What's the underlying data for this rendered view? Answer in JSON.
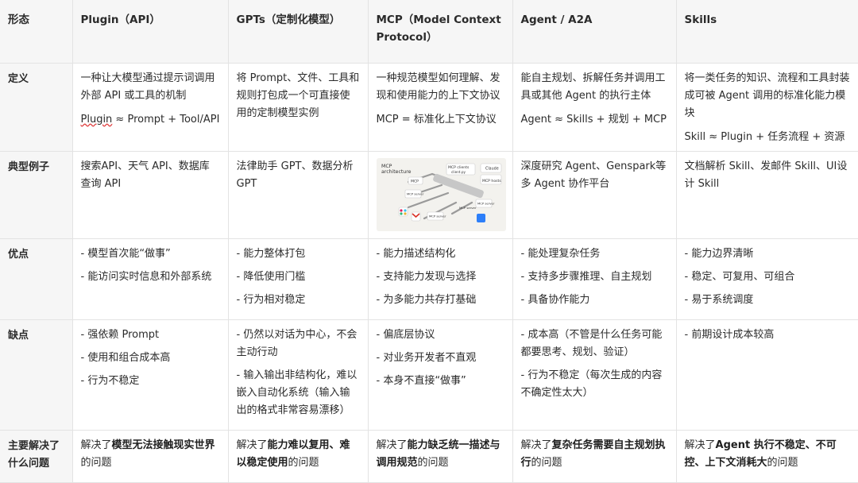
{
  "header": {
    "row_label": "形态",
    "cols": [
      "Plugin（API）",
      "GPTs（定制化模型）",
      "MCP（Model Context Protocol）",
      "Agent / A2A",
      "Skills"
    ]
  },
  "rows": {
    "definition": {
      "label": "定义",
      "plugin": [
        "一种让大模型通过提示词调用外部 API 或工具的机制"
      ],
      "plugin_formula_word": "Plugin",
      "plugin_formula_rest": " ≈ Prompt + Tool/API",
      "gpts": [
        "将 Prompt、文件、工具和规则打包成一个可直接使用的定制模型实例"
      ],
      "mcp": [
        "一种规范模型如何理解、发现和使用能力的上下文协议",
        "MCP = 标准化上下文协议"
      ],
      "agent": [
        "能自主规划、拆解任务并调用工具或其他 Agent 的执行主体",
        "Agent ≈ Skills + 规划 + MCP"
      ],
      "skills": [
        "将一类任务的知识、流程和工具封装成可被 Agent 调用的标准化能力模块",
        "Skill ≈ Plugin + 任务流程  + 资源"
      ]
    },
    "examples": {
      "label": "典型例子",
      "plugin": "搜索API、天气 API、数据库查询 API",
      "gpts": "法律助手 GPT、数据分析 GPT",
      "mcp_diagram": {
        "title": "MCP architecture",
        "labels": [
          "MCP clients",
          "client.py",
          "Claude",
          "MCP hosts",
          "MCP",
          "MCP server",
          "MCP server",
          "MCP server",
          "MCP server"
        ]
      },
      "agent": "深度研究 Agent、Genspark等多 Agent 协作平台",
      "skills": "文档解析 Skill、发邮件 Skill、UI设计 Skill"
    },
    "pros": {
      "label": "优点",
      "plugin": [
        "- 模型首次能“做事”",
        "- 能访问实时信息和外部系统"
      ],
      "gpts": [
        "- 能力整体打包",
        "- 降低使用门槛",
        "- 行为相对稳定"
      ],
      "mcp": [
        "- 能力描述结构化",
        "- 支持能力发现与选择",
        "- 为多能力共存打基础"
      ],
      "agent": [
        "- 能处理复杂任务",
        "- 支持多步骤推理、自主规划",
        "- 具备协作能力"
      ],
      "skills": [
        "- 能力边界清晰",
        "- 稳定、可复用、可组合",
        "- 易于系统调度"
      ]
    },
    "cons": {
      "label": "缺点",
      "plugin": [
        "- 强依赖 Prompt",
        "- 使用和组合成本高",
        "- 行为不稳定"
      ],
      "gpts": [
        "- 仍然以对话为中心，不会主动行动",
        "- 输入输出非结构化，难以嵌入自动化系统（输入输出的格式非常容易漂移）"
      ],
      "mcp": [
        "- 偏底层协议",
        "- 对业务开发者不直观",
        "- 本身不直接“做事”"
      ],
      "agent": [
        "- 成本高（不管是什么任务可能都要思考、规划、验证）",
        "- 行为不稳定（每次生成的内容不确定性太大）"
      ],
      "skills": [
        "- 前期设计成本较高"
      ]
    },
    "solves": {
      "label": "主要解决了什么问题",
      "prefix": "解决了",
      "suffix": "的问题",
      "plugin": "模型无法接触现实世界",
      "gpts": "能力难以复用、难以稳定使用",
      "mcp": "能力缺乏统一描述与调用规范",
      "agent": "复杂任务需要自主规划执行",
      "skills": "Agent 执行不稳定、不可控、上下文消耗大"
    }
  }
}
